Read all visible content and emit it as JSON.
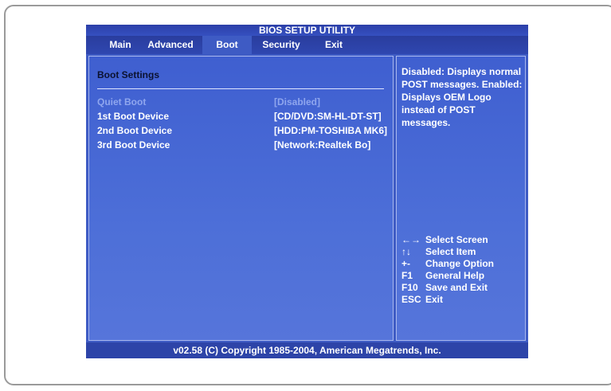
{
  "title": "BIOS SETUP UTILITY",
  "tabs": [
    {
      "label": "Main"
    },
    {
      "label": "Advanced"
    },
    {
      "label": "Boot",
      "active": true
    },
    {
      "label": "Security"
    },
    {
      "label": "Exit"
    }
  ],
  "section_title": "Boot Settings",
  "settings": [
    {
      "label": "Quiet Boot",
      "value": "[Disabled]",
      "selected": true
    },
    {
      "label": "1st Boot Device",
      "value": "[CD/DVD:SM-HL-DT-ST]"
    },
    {
      "label": "2nd Boot Device",
      "value": "[HDD:PM-TOSHIBA MK6]"
    },
    {
      "label": "3rd Boot Device",
      "value": "[Network:Realtek Bo]"
    }
  ],
  "help_text": "Disabled: Displays normal POST messages. Enabled: Displays OEM Logo instead of POST messages.",
  "key_legend": [
    {
      "key": "←→",
      "desc": "Select Screen"
    },
    {
      "key": "↑↓",
      "desc": "Select Item"
    },
    {
      "key": "+-",
      "desc": "Change Option"
    },
    {
      "key": "F1",
      "desc": "General Help"
    },
    {
      "key": "F10",
      "desc": "Save and Exit"
    },
    {
      "key": "ESC",
      "desc": "Exit"
    }
  ],
  "footer": "v02.58 (C) Copyright 1985-2004, American Megatrends, Inc.",
  "colors": {
    "background": "#3e5bc4",
    "selected_text": "#8fa6ee",
    "text": "#ffffff"
  }
}
